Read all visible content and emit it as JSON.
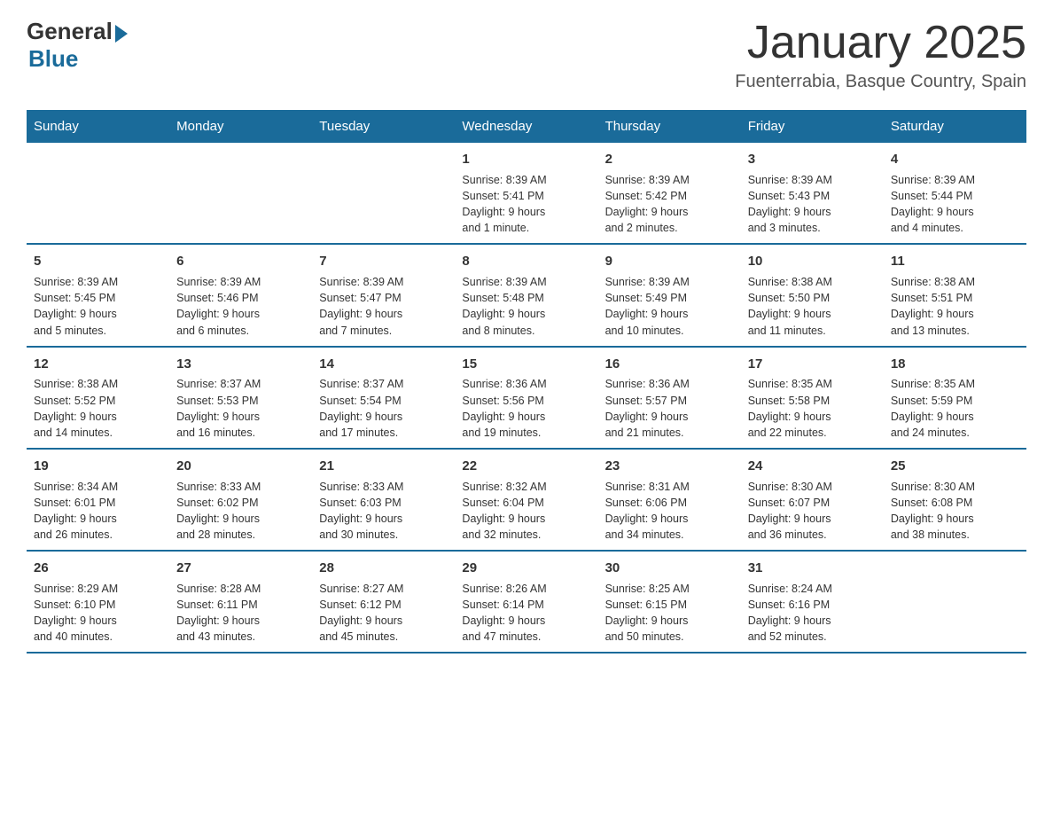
{
  "logo": {
    "general": "General",
    "blue": "Blue"
  },
  "title": "January 2025",
  "subtitle": "Fuenterrabia, Basque Country, Spain",
  "days_of_week": [
    "Sunday",
    "Monday",
    "Tuesday",
    "Wednesday",
    "Thursday",
    "Friday",
    "Saturday"
  ],
  "weeks": [
    [
      {
        "day": "",
        "info": ""
      },
      {
        "day": "",
        "info": ""
      },
      {
        "day": "",
        "info": ""
      },
      {
        "day": "1",
        "info": "Sunrise: 8:39 AM\nSunset: 5:41 PM\nDaylight: 9 hours\nand 1 minute."
      },
      {
        "day": "2",
        "info": "Sunrise: 8:39 AM\nSunset: 5:42 PM\nDaylight: 9 hours\nand 2 minutes."
      },
      {
        "day": "3",
        "info": "Sunrise: 8:39 AM\nSunset: 5:43 PM\nDaylight: 9 hours\nand 3 minutes."
      },
      {
        "day": "4",
        "info": "Sunrise: 8:39 AM\nSunset: 5:44 PM\nDaylight: 9 hours\nand 4 minutes."
      }
    ],
    [
      {
        "day": "5",
        "info": "Sunrise: 8:39 AM\nSunset: 5:45 PM\nDaylight: 9 hours\nand 5 minutes."
      },
      {
        "day": "6",
        "info": "Sunrise: 8:39 AM\nSunset: 5:46 PM\nDaylight: 9 hours\nand 6 minutes."
      },
      {
        "day": "7",
        "info": "Sunrise: 8:39 AM\nSunset: 5:47 PM\nDaylight: 9 hours\nand 7 minutes."
      },
      {
        "day": "8",
        "info": "Sunrise: 8:39 AM\nSunset: 5:48 PM\nDaylight: 9 hours\nand 8 minutes."
      },
      {
        "day": "9",
        "info": "Sunrise: 8:39 AM\nSunset: 5:49 PM\nDaylight: 9 hours\nand 10 minutes."
      },
      {
        "day": "10",
        "info": "Sunrise: 8:38 AM\nSunset: 5:50 PM\nDaylight: 9 hours\nand 11 minutes."
      },
      {
        "day": "11",
        "info": "Sunrise: 8:38 AM\nSunset: 5:51 PM\nDaylight: 9 hours\nand 13 minutes."
      }
    ],
    [
      {
        "day": "12",
        "info": "Sunrise: 8:38 AM\nSunset: 5:52 PM\nDaylight: 9 hours\nand 14 minutes."
      },
      {
        "day": "13",
        "info": "Sunrise: 8:37 AM\nSunset: 5:53 PM\nDaylight: 9 hours\nand 16 minutes."
      },
      {
        "day": "14",
        "info": "Sunrise: 8:37 AM\nSunset: 5:54 PM\nDaylight: 9 hours\nand 17 minutes."
      },
      {
        "day": "15",
        "info": "Sunrise: 8:36 AM\nSunset: 5:56 PM\nDaylight: 9 hours\nand 19 minutes."
      },
      {
        "day": "16",
        "info": "Sunrise: 8:36 AM\nSunset: 5:57 PM\nDaylight: 9 hours\nand 21 minutes."
      },
      {
        "day": "17",
        "info": "Sunrise: 8:35 AM\nSunset: 5:58 PM\nDaylight: 9 hours\nand 22 minutes."
      },
      {
        "day": "18",
        "info": "Sunrise: 8:35 AM\nSunset: 5:59 PM\nDaylight: 9 hours\nand 24 minutes."
      }
    ],
    [
      {
        "day": "19",
        "info": "Sunrise: 8:34 AM\nSunset: 6:01 PM\nDaylight: 9 hours\nand 26 minutes."
      },
      {
        "day": "20",
        "info": "Sunrise: 8:33 AM\nSunset: 6:02 PM\nDaylight: 9 hours\nand 28 minutes."
      },
      {
        "day": "21",
        "info": "Sunrise: 8:33 AM\nSunset: 6:03 PM\nDaylight: 9 hours\nand 30 minutes."
      },
      {
        "day": "22",
        "info": "Sunrise: 8:32 AM\nSunset: 6:04 PM\nDaylight: 9 hours\nand 32 minutes."
      },
      {
        "day": "23",
        "info": "Sunrise: 8:31 AM\nSunset: 6:06 PM\nDaylight: 9 hours\nand 34 minutes."
      },
      {
        "day": "24",
        "info": "Sunrise: 8:30 AM\nSunset: 6:07 PM\nDaylight: 9 hours\nand 36 minutes."
      },
      {
        "day": "25",
        "info": "Sunrise: 8:30 AM\nSunset: 6:08 PM\nDaylight: 9 hours\nand 38 minutes."
      }
    ],
    [
      {
        "day": "26",
        "info": "Sunrise: 8:29 AM\nSunset: 6:10 PM\nDaylight: 9 hours\nand 40 minutes."
      },
      {
        "day": "27",
        "info": "Sunrise: 8:28 AM\nSunset: 6:11 PM\nDaylight: 9 hours\nand 43 minutes."
      },
      {
        "day": "28",
        "info": "Sunrise: 8:27 AM\nSunset: 6:12 PM\nDaylight: 9 hours\nand 45 minutes."
      },
      {
        "day": "29",
        "info": "Sunrise: 8:26 AM\nSunset: 6:14 PM\nDaylight: 9 hours\nand 47 minutes."
      },
      {
        "day": "30",
        "info": "Sunrise: 8:25 AM\nSunset: 6:15 PM\nDaylight: 9 hours\nand 50 minutes."
      },
      {
        "day": "31",
        "info": "Sunrise: 8:24 AM\nSunset: 6:16 PM\nDaylight: 9 hours\nand 52 minutes."
      },
      {
        "day": "",
        "info": ""
      }
    ]
  ]
}
